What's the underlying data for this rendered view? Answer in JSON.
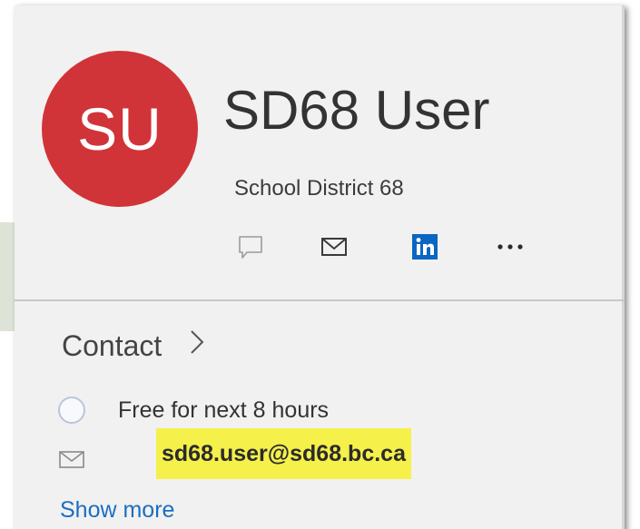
{
  "profile": {
    "initials": "SU",
    "name": "SD68 User",
    "organization": "School District 68",
    "avatar_color": "#d13438"
  },
  "actions": [
    {
      "icon": "chat-icon",
      "label": "Chat"
    },
    {
      "icon": "mail-icon",
      "label": "Email"
    },
    {
      "icon": "linkedin-icon",
      "label": "LinkedIn"
    },
    {
      "icon": "more-icon",
      "label": "More"
    }
  ],
  "contact": {
    "title": "Contact",
    "presence": "Free for next 8 hours",
    "email": "sd68.user@sd68.bc.ca",
    "show_more": "Show more",
    "highlight_color": "#f5f04a",
    "link_color": "#1b6ec2"
  }
}
